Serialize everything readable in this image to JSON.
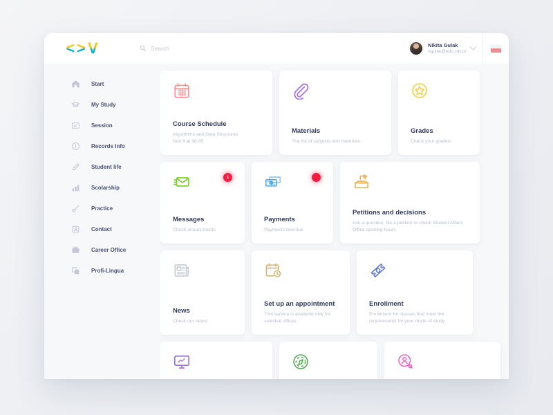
{
  "header": {
    "logo_text": [
      "<",
      ">",
      "V"
    ],
    "search": {
      "placeholder": "Search",
      "value": "",
      "icon": "search-icon"
    },
    "user": {
      "name": "Nikita Gulak",
      "email": "ngulak@edu.cdv.pl",
      "avatar": "user-avatar",
      "dropdown_icon": "chevron-down-icon"
    },
    "language": {
      "flag": "poland-flag",
      "colors": [
        "#ffffff",
        "#ef8a93"
      ]
    }
  },
  "sidebar": {
    "items": [
      {
        "label": "Start",
        "icon": "home-icon"
      },
      {
        "label": "My Study",
        "icon": "graduation-cap-icon"
      },
      {
        "label": "Session",
        "icon": "session-book-icon"
      },
      {
        "label": "Records Info",
        "icon": "info-circle-icon"
      },
      {
        "label": "Student life",
        "icon": "pencil-icon"
      },
      {
        "label": "Scolarship",
        "icon": "bar-chart-icon"
      },
      {
        "label": "Practice",
        "icon": "tool-icon"
      },
      {
        "label": "Contact",
        "icon": "contact-card-icon"
      },
      {
        "label": "Career Office",
        "icon": "briefcase-icon"
      },
      {
        "label": "Profi-Lingua",
        "icon": "layers-icon"
      }
    ]
  },
  "cards": {
    "course_schedule": {
      "title": "Course Schedule",
      "sub1": "Algorithms and Data Structures",
      "sub2": "Nov 8 at 08:45",
      "icon": "calendar-icon",
      "color": "#f98b93"
    },
    "materials": {
      "title": "Materials",
      "sub": "The list of subjects and materials",
      "icon": "paperclip-icon",
      "color": "#a970e8"
    },
    "grades": {
      "title": "Grades",
      "sub": "Check your grades!",
      "icon": "star-circle-icon",
      "color": "#f2d049"
    },
    "messages": {
      "title": "Messages",
      "sub": "Check anouncments",
      "icon": "envelope-icon",
      "color": "#7ed321",
      "badge": "1"
    },
    "payments": {
      "title": "Payments",
      "sub": "Payments overdue",
      "icon": "money-icon",
      "color": "#4aa3f0",
      "badge": ""
    },
    "petitions": {
      "title": "Petitions and decisions",
      "sub": "Ask a question, file a petition or check Student Affairs Office opening hours",
      "icon": "ballot-box-icon",
      "color": "#f0b254"
    },
    "news": {
      "title": "News",
      "sub": "Check our news!",
      "icon": "newspaper-icon",
      "color": "#c6cad6"
    },
    "appointment": {
      "title": "Set up an appointment",
      "sub1": "This service is available only for",
      "sub2": "selected offices",
      "icon": "calendar-clock-icon",
      "color": "#d4b972"
    },
    "enrollment": {
      "title": "Enrollment",
      "sub1": "Enrollment for classes that meet the",
      "sub2": "requirements for your mode of study",
      "icon": "ticket-icon",
      "color": "#5a72d8"
    },
    "monitor": {
      "icon": "monitor-icon",
      "color": "#9b6fd8"
    },
    "compass": {
      "icon": "compass-icon",
      "color": "#4caf50"
    },
    "person_search": {
      "icon": "person-search-icon",
      "color": "#e667c5"
    }
  }
}
